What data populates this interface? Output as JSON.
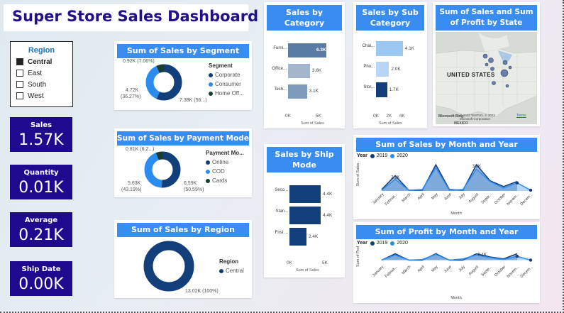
{
  "title": "Super Store Sales Dashboard",
  "region": {
    "title": "Region",
    "items": [
      {
        "label": "Central",
        "checked": true
      },
      {
        "label": "East",
        "checked": false
      },
      {
        "label": "South",
        "checked": false
      },
      {
        "label": "West",
        "checked": false
      }
    ]
  },
  "kpis": [
    {
      "label": "Sales",
      "value": "1.57K"
    },
    {
      "label": "Quantity",
      "value": "0.01K"
    },
    {
      "label": "Average",
      "value": "0.21K"
    },
    {
      "label": "Ship Date",
      "value": "0.00K"
    }
  ],
  "segment": {
    "title": "Sum of Sales by Segment",
    "legend_title": "Segment",
    "legend": [
      "Corporate",
      "Consumer",
      "Home Off..."
    ],
    "colors": [
      "#123e7a",
      "#2b8cf0",
      "#1a3d33"
    ],
    "label_a": "0.92K (7.06%)",
    "label_b1": "4.72K",
    "label_b2": "(36.27%)",
    "label_c": "7.38K (56...)"
  },
  "payment": {
    "title": "Sum of Sales by Payment Mode",
    "legend_title": "Payment Mo...",
    "legend": [
      "Online",
      "COD",
      "Cards"
    ],
    "label_a": "0.81K (6.2...)",
    "label_b1": "5.63K",
    "label_b2": "(43.19%)",
    "label_c1": "6.59K",
    "label_c2": "(50.59%)"
  },
  "region_sales": {
    "title": "Sum of Sales by Region",
    "legend_title": "Region",
    "legend": [
      "Central"
    ],
    "label": "13.02K (100%)"
  },
  "category": {
    "title": "Sales by Category",
    "items": [
      {
        "label": "Furni...",
        "value_label": "6.3K",
        "color": "#5a7ba3"
      },
      {
        "label": "Office...",
        "value_label": "3.6K",
        "color": "#a3b6cc"
      },
      {
        "label": "Tech...",
        "value_label": "3.1K",
        "color": "#7f9bbb"
      }
    ],
    "ticks": [
      "0K",
      "5K"
    ],
    "axis": "Sum of Sales"
  },
  "subcategory": {
    "title": "Sales by Sub Category",
    "items": [
      {
        "label": "Chai...",
        "value_label": "4.1K",
        "color": "#9cc7f3"
      },
      {
        "label": "Pho...",
        "value_label": "2.0K",
        "color": "#b7d6f7"
      },
      {
        "label": "Stor...",
        "value_label": "1.7K",
        "color": "#123e7a"
      }
    ],
    "ticks": [
      "0K",
      "2K",
      "4K"
    ],
    "axis": "Sum of Sales"
  },
  "map": {
    "title": "Sum of Sales and Sum of Profit by State",
    "country_label": "UNITED STATES",
    "copyright": "© 2023 TomTom, © 2023 Microsoft Corporation",
    "terms": "Terms",
    "brand": "Microsoft Bing",
    "bottom": "MEXICO"
  },
  "shipmode": {
    "title": "Sales by Ship Mode",
    "items": [
      {
        "label": "Seco...",
        "value_label": "4.4K"
      },
      {
        "label": "Stan...",
        "value_label": "4.4K"
      },
      {
        "label": "First ...",
        "value_label": "2.4K"
      }
    ],
    "ticks": [
      "0K",
      "5K"
    ],
    "axis": "Sum of Sales"
  },
  "sales_month": {
    "title": "Sum of Sales by Month and Year",
    "legend_label": "Year",
    "series_names": [
      "2019",
      "2020"
    ],
    "ylabel": "Sum of Sales",
    "xlabel": "Month",
    "months": [
      "January",
      "Februa...",
      "March",
      "April",
      "May",
      "June",
      "July",
      "August",
      "Septe...",
      "October",
      "Novem...",
      "Decem..."
    ],
    "point_labels": [
      "2.1K",
      "3.6K"
    ]
  },
  "profit_month": {
    "title": "Sum of Profit by Month and Year",
    "legend_label": "Year",
    "series_names": [
      "2019",
      "2020"
    ],
    "ylabel": "Sum of Profit",
    "xlabel": "Month",
    "months": [
      "January",
      "Februa...",
      "March",
      "April",
      "May",
      "June",
      "July",
      "August",
      "Septe...",
      "October",
      "Novem...",
      "Decem..."
    ],
    "point_label": "0.1K"
  },
  "chart_data": [
    {
      "type": "bar",
      "title": "Sales by Category",
      "categories": [
        "Furni...",
        "Office...",
        "Tech..."
      ],
      "values": [
        6.3,
        3.6,
        3.1
      ],
      "unit": "K",
      "xlabel": "Sum of Sales",
      "xlim": [
        0,
        7
      ]
    },
    {
      "type": "bar",
      "title": "Sales by Sub Category",
      "categories": [
        "Chai...",
        "Pho...",
        "Stor..."
      ],
      "values": [
        4.1,
        2.0,
        1.7
      ],
      "unit": "K",
      "xlabel": "Sum of Sales",
      "xlim": [
        0,
        5
      ]
    },
    {
      "type": "bar",
      "title": "Sales by Ship Mode",
      "categories": [
        "Seco...",
        "Stan...",
        "First ..."
      ],
      "values": [
        4.4,
        4.4,
        2.4
      ],
      "unit": "K",
      "xlabel": "Sum of Sales",
      "xlim": [
        0,
        6
      ]
    },
    {
      "type": "pie",
      "title": "Sum of Sales by Segment",
      "categories": [
        "Corporate",
        "Consumer",
        "Home Off..."
      ],
      "values": [
        7.38,
        4.72,
        0.92
      ],
      "percent": [
        56.67,
        36.27,
        7.06
      ]
    },
    {
      "type": "pie",
      "title": "Sum of Sales by Payment Mode",
      "categories": [
        "Online",
        "COD",
        "Cards"
      ],
      "values": [
        6.59,
        5.63,
        0.81
      ],
      "percent": [
        50.59,
        43.19,
        6.22
      ]
    },
    {
      "type": "pie",
      "title": "Sum of Sales by Region",
      "categories": [
        "Central"
      ],
      "values": [
        13.02
      ],
      "percent": [
        100
      ]
    },
    {
      "type": "area",
      "title": "Sum of Sales by Month and Year",
      "categories": [
        "January",
        "Februa...",
        "March",
        "April",
        "May",
        "June",
        "July",
        "August",
        "Septe...",
        "October",
        "Novem...",
        "Decem..."
      ],
      "series": [
        {
          "name": "2019",
          "values": [
            0.2,
            2.1,
            0.1,
            0.1,
            3.6,
            0.2,
            0.1,
            3.6,
            1.4,
            0.6,
            1.3,
            null
          ]
        },
        {
          "name": "2020",
          "values": [
            0.1,
            1.6,
            0.1,
            0.2,
            3.2,
            0.1,
            0.2,
            3.0,
            1.3,
            0.4,
            1.1,
            0.1
          ]
        }
      ],
      "xlabel": "Month",
      "ylabel": "Sum of Sales",
      "ylim": [
        0,
        4
      ]
    },
    {
      "type": "area",
      "title": "Sum of Profit by Month and Year",
      "categories": [
        "January",
        "Februa...",
        "March",
        "April",
        "May",
        "June",
        "July",
        "August",
        "Septe...",
        "October",
        "Novem...",
        "Decem..."
      ],
      "series": [
        {
          "name": "2019",
          "values": [
            0.0,
            0.1,
            0.0,
            0.0,
            0.1,
            0.0,
            0.0,
            0.1,
            0.05,
            0.02,
            0.1,
            null
          ]
        },
        {
          "name": "2020",
          "values": [
            0.0,
            0.08,
            0.0,
            0.01,
            0.09,
            0.0,
            0.02,
            0.08,
            0.04,
            0.01,
            0.06,
            0.0
          ]
        }
      ],
      "xlabel": "Month",
      "ylabel": "Sum of Profit",
      "ylim": [
        -0.05,
        0.15
      ]
    }
  ]
}
